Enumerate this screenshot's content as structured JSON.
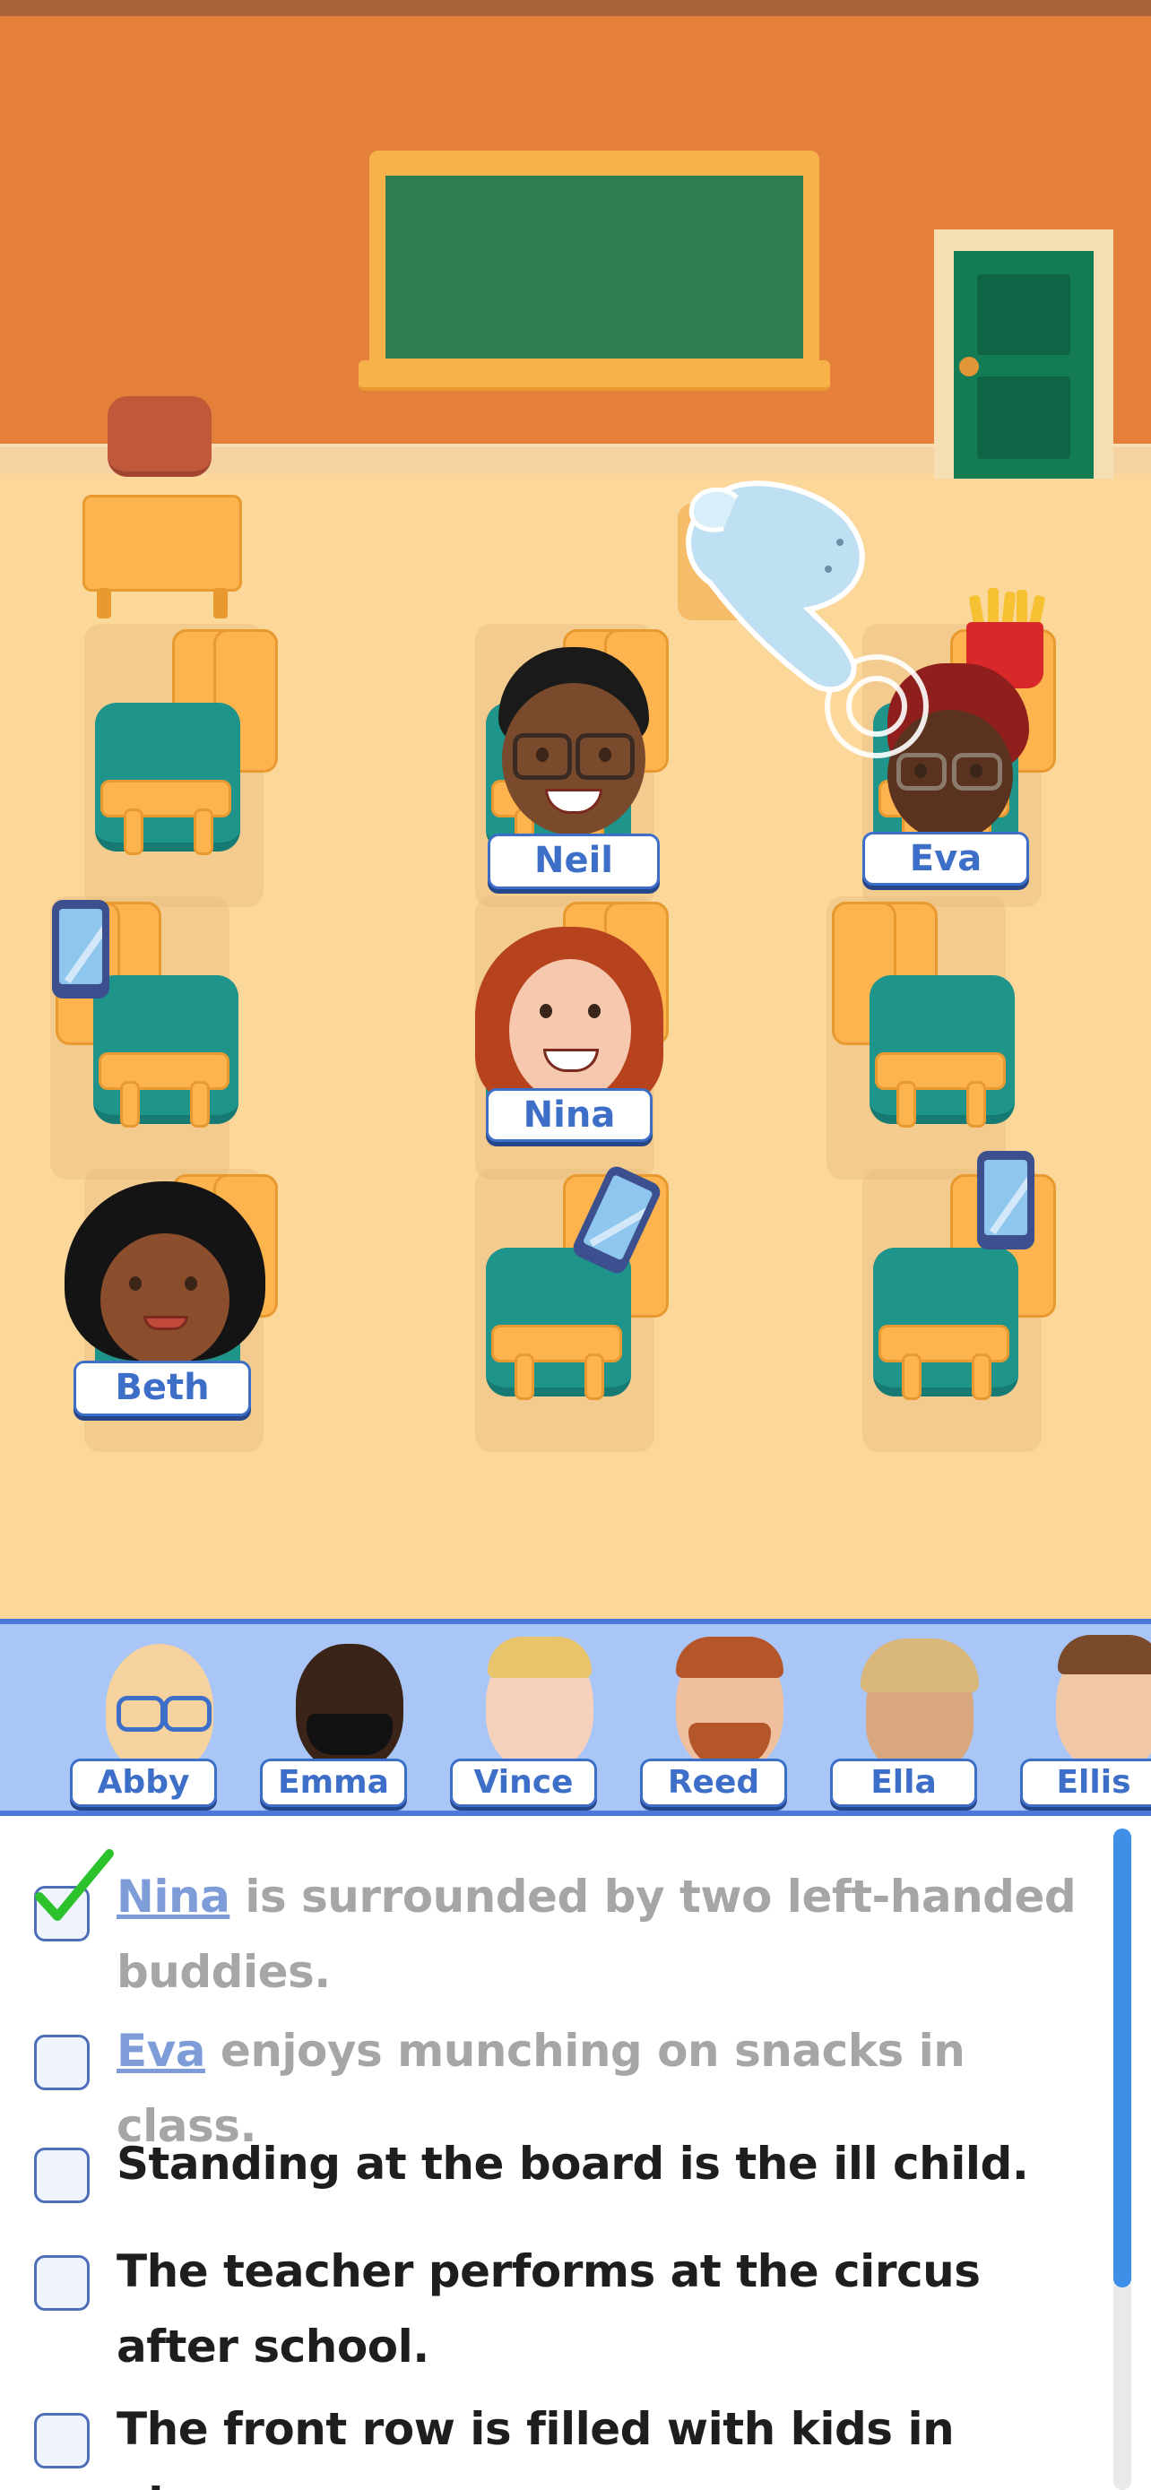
{
  "classroom": {
    "seats": [
      {
        "id": "r1c1",
        "name": ""
      },
      {
        "id": "r1c2",
        "name": "Neil"
      },
      {
        "id": "r1c3",
        "name": "Eva"
      },
      {
        "id": "r2c1",
        "name": ""
      },
      {
        "id": "r2c2",
        "name": "Nina"
      },
      {
        "id": "r2c3",
        "name": ""
      },
      {
        "id": "r3c1",
        "name": "Beth"
      },
      {
        "id": "r3c2",
        "name": ""
      },
      {
        "id": "r3c3",
        "name": ""
      }
    ]
  },
  "roster": {
    "names": [
      "Abby",
      "Emma",
      "Vince",
      "Reed",
      "Ella",
      "Ellis"
    ]
  },
  "clues": [
    {
      "done": true,
      "highlight": "Nina",
      "text": " is surrounded by two left-handed buddies."
    },
    {
      "done": false,
      "highlight": "Eva",
      "text": " enjoys munching on snacks in class."
    },
    {
      "done": false,
      "highlight": "",
      "text": "Standing at the board is the ill child."
    },
    {
      "done": false,
      "highlight": "",
      "text": "The teacher performs at the circus after school."
    },
    {
      "done": false,
      "highlight": "",
      "text": "The front row is filled with kids in glasses"
    }
  ],
  "colors": {
    "wall": "#E4803A",
    "floor": "#FBD79A",
    "chalkboard": "#2E7D50",
    "door": "#137C55",
    "desk_teal": "#1E948A",
    "desk_wood": "#FDB44E",
    "name_tag": "#3E6FC8",
    "roster_bg": "#A9C6F7",
    "scrollbar": "#3D8FE8"
  },
  "icons": [
    "hand-pointer-icon",
    "checkmark-icon",
    "phone-icon",
    "fries-icon"
  ]
}
